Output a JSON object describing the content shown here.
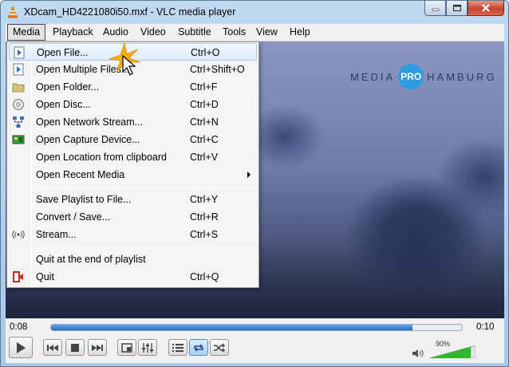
{
  "window": {
    "title": "XDcam_HD4221080i50.mxf - VLC media player"
  },
  "menubar": {
    "items": [
      {
        "label": "Media"
      },
      {
        "label": "Playback"
      },
      {
        "label": "Audio"
      },
      {
        "label": "Video"
      },
      {
        "label": "Subtitle"
      },
      {
        "label": "Tools"
      },
      {
        "label": "View"
      },
      {
        "label": "Help"
      }
    ]
  },
  "media_menu": {
    "items": [
      {
        "label": "Open File...",
        "shortcut": "Ctrl+O",
        "icon": "open-file-icon"
      },
      {
        "label": "Open Multiple Files...",
        "shortcut": "Ctrl+Shift+O",
        "icon": "open-multiple-files-icon"
      },
      {
        "label": "Open Folder...",
        "shortcut": "Ctrl+F",
        "icon": "folder-icon"
      },
      {
        "label": "Open Disc...",
        "shortcut": "Ctrl+D",
        "icon": "disc-icon"
      },
      {
        "label": "Open Network Stream...",
        "shortcut": "Ctrl+N",
        "icon": "network-icon"
      },
      {
        "label": "Open Capture Device...",
        "shortcut": "Ctrl+C",
        "icon": "capture-card-icon"
      },
      {
        "label": "Open Location from clipboard",
        "shortcut": "Ctrl+V",
        "icon": ""
      },
      {
        "label": "Open Recent Media",
        "shortcut": "",
        "icon": ""
      },
      {
        "label": "Save Playlist to File...",
        "shortcut": "Ctrl+Y",
        "icon": ""
      },
      {
        "label": "Convert / Save...",
        "shortcut": "Ctrl+R",
        "icon": ""
      },
      {
        "label": "Stream...",
        "shortcut": "Ctrl+S",
        "icon": "stream-icon"
      },
      {
        "label": "Quit at the end of playlist",
        "shortcut": "",
        "icon": ""
      },
      {
        "label": "Quit",
        "shortcut": "Ctrl+Q",
        "icon": "quit-icon"
      }
    ],
    "highlighted_index": 0
  },
  "video": {
    "watermark_left": "MEDIA",
    "watermark_circle": "PRO",
    "watermark_right": "HAMBURG"
  },
  "playback": {
    "elapsed": "0:08",
    "total": "0:10",
    "progress_fraction": 0.88,
    "volume_label": "90%",
    "volume_fraction": 0.9
  },
  "colors": {
    "accent": "#2a6fc0",
    "volume_green": "#2fb82f",
    "watermark_blue": "#2f9be0"
  }
}
